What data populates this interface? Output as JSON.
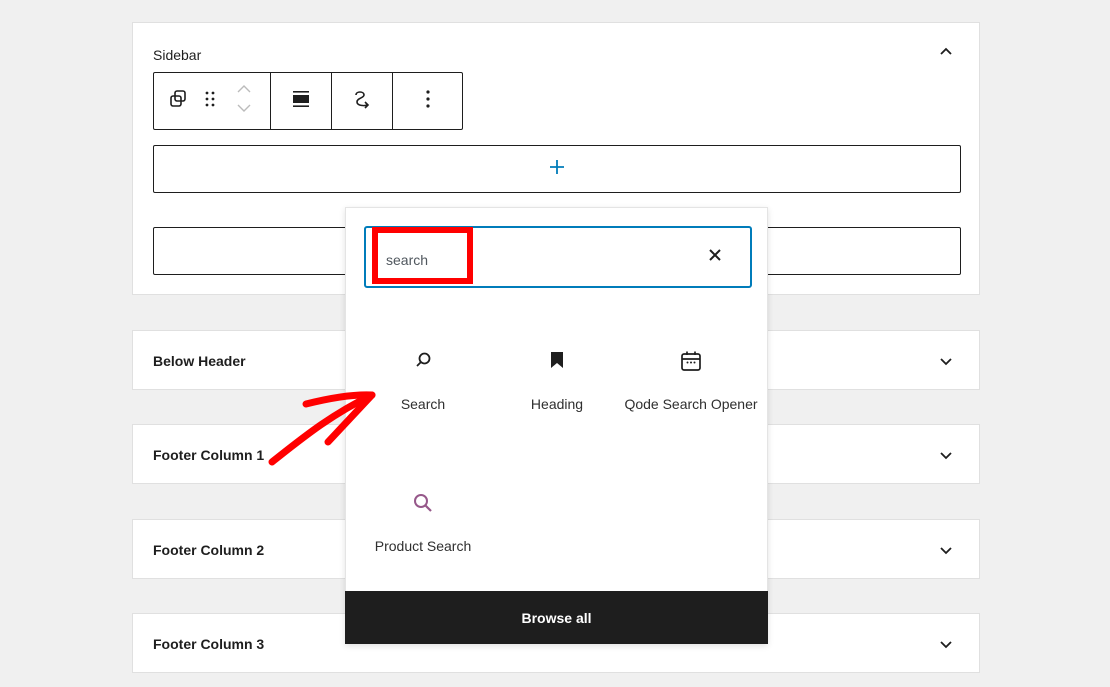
{
  "sidebar_panel": {
    "title": "Sidebar",
    "toggle_icon": "chevron-up-icon",
    "toolbar": {
      "buttons": [
        {
          "name": "block-type",
          "icon": "duplicate-icon"
        },
        {
          "name": "drag",
          "icon": "drag-handle-icon"
        },
        {
          "name": "move-up",
          "icon": "chevron-up-icon"
        },
        {
          "name": "move-down",
          "icon": "chevron-down-icon"
        },
        {
          "name": "align",
          "icon": "align-wide-icon"
        },
        {
          "name": "transform",
          "icon": "transform-loop-icon"
        },
        {
          "name": "more-options",
          "icon": "more-vertical-icon"
        }
      ]
    },
    "appender_icon": "plus-icon",
    "accent_color": "#007cba"
  },
  "panels": [
    {
      "title": "Below Header"
    },
    {
      "title": "Footer Column 1"
    },
    {
      "title": "Footer Column 2"
    },
    {
      "title": "Footer Column 3"
    }
  ],
  "inserter": {
    "search_value": "search",
    "clear_icon": "close-icon",
    "results": [
      {
        "label": "Search",
        "icon": "search-icon"
      },
      {
        "label": "Heading",
        "icon": "bookmark-icon"
      },
      {
        "label": "Qode Search Opener",
        "icon": "calendar-icon"
      },
      {
        "label": "Product Search",
        "icon": "product-search-icon",
        "icon_color": "#96588a"
      }
    ],
    "browse_all_label": "Browse all"
  },
  "annotation": {
    "highlight_color": "#ff0000",
    "arrow_color": "#ff0000"
  }
}
